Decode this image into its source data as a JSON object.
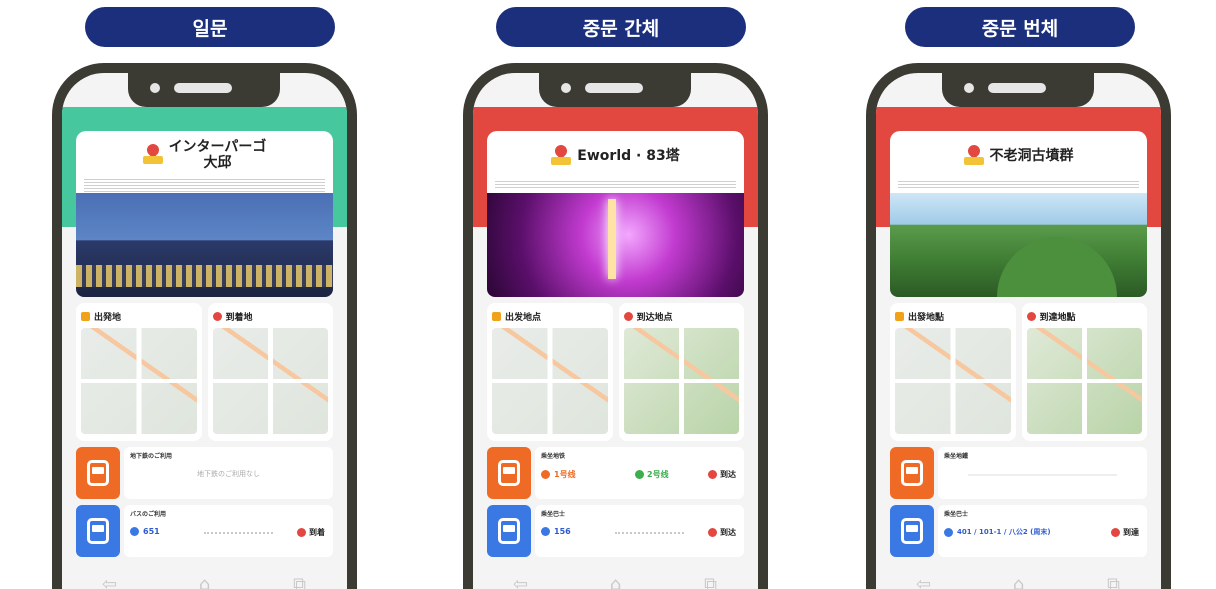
{
  "columns": [
    {
      "language": "일문",
      "title": "インターパーゴ\n大邱",
      "title_line1": "インターパーゴ",
      "title_line2": "大邱",
      "band": "green",
      "photo": "building",
      "start_label": "出発地",
      "end_label": "到着地",
      "transit1_label": "地下鉄のご利用",
      "transit1_note": "地下鉄のご利用なし",
      "transit2_label": "バスのご利用",
      "transit2_line": "651",
      "transit2_arrive": "到着"
    },
    {
      "language": "중문 간체",
      "title_line1": "Eworld · 83塔",
      "band": "red",
      "photo": "night",
      "start_label": "出发地点",
      "end_label": "到达地点",
      "transit1_label": "乘坐地铁",
      "transit1_line": "1号线",
      "transit1_mid": "2号线",
      "transit1_arrive": "到达",
      "transit2_label": "乘坐巴士",
      "transit2_line": "156",
      "transit2_arrive": "到达"
    },
    {
      "language": "중문 번체",
      "title_line1": "不老洞古墳群",
      "band": "red",
      "photo": "hills",
      "start_label": "出發地點",
      "end_label": "到達地點",
      "transit1_label": "乘坐地鐵",
      "transit2_label": "乘坐巴士",
      "transit2_line": "401 / 101-1 / 八公2 (周末)",
      "transit2_arrive": "到達"
    }
  ],
  "nav": {
    "back_icon": "back-arrow-icon",
    "home_icon": "home-icon",
    "translate_icon": "translate-icon"
  },
  "colors": {
    "pill": "#1b2f7d",
    "green_band": "#46c79d",
    "red_band": "#e2483f",
    "train": "#ef6b25",
    "bus": "#3a78e3"
  }
}
